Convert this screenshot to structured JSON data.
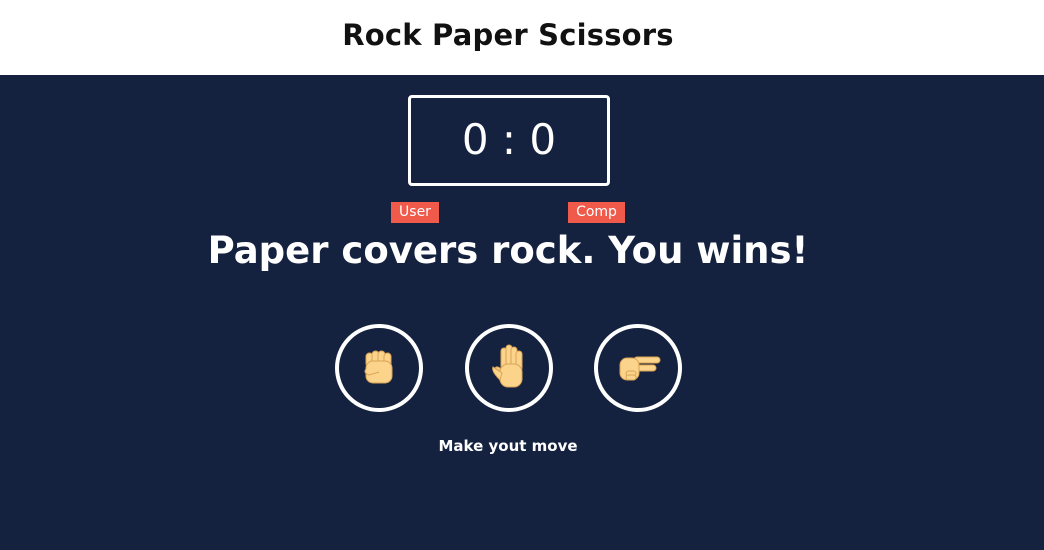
{
  "header": {
    "title": "Rock Paper Scissors"
  },
  "scoreboard": {
    "user_label": "User",
    "comp_label": "Comp",
    "user_score": 0,
    "comp_score": 0,
    "score_display": "0 : 0"
  },
  "result": {
    "message": "Paper covers rock. You wins!"
  },
  "choices": [
    {
      "name": "rock",
      "icon": "raised-fist-icon"
    },
    {
      "name": "paper",
      "icon": "raised-hand-icon"
    },
    {
      "name": "scissors",
      "icon": "victory-hand-icon"
    }
  ],
  "prompt": {
    "text": "Make yout move"
  },
  "colors": {
    "background": "#15223f",
    "header_background": "#ffffff",
    "badge": "#f05a4a",
    "accent": "#ffffff",
    "hand_skin": "#fcd38a"
  }
}
